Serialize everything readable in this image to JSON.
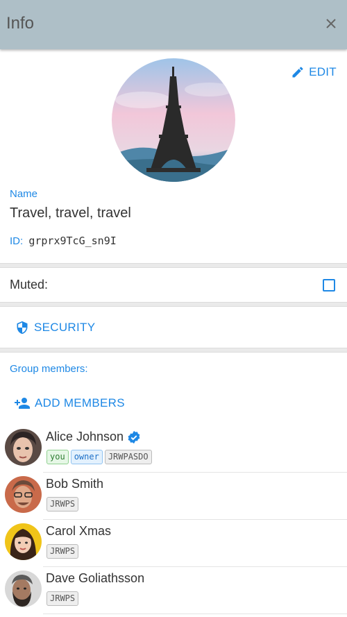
{
  "header": {
    "title": "Info"
  },
  "profile": {
    "edit_label": "EDIT",
    "name_label": "Name",
    "name_value": "Travel, travel, travel",
    "id_label": "ID:",
    "id_value": "grprx9TcG_sn9I"
  },
  "muted": {
    "label": "Muted:",
    "checked": false
  },
  "security": {
    "label": "SECURITY"
  },
  "members": {
    "label": "Group members:",
    "add_label": "ADD MEMBERS",
    "items": [
      {
        "name": "Alice Johnson",
        "verified": true,
        "badges": [
          "you",
          "owner",
          "JRWPASDO"
        ]
      },
      {
        "name": "Bob Smith",
        "verified": false,
        "badges": [
          "JRWPS"
        ]
      },
      {
        "name": "Carol Xmas",
        "verified": false,
        "badges": [
          "JRWPS"
        ]
      },
      {
        "name": "Dave Goliathsson",
        "verified": false,
        "badges": [
          "JRWPS"
        ]
      }
    ]
  },
  "colors": {
    "accent": "#1e88e5",
    "header_bg": "#aebfc7"
  }
}
